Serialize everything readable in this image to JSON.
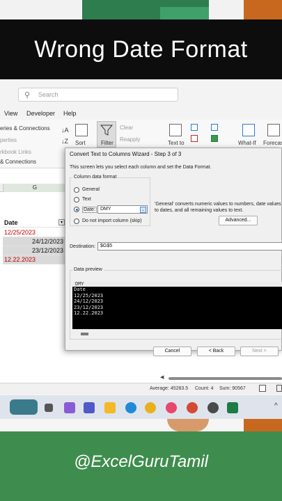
{
  "banner": {
    "title": "Wrong Date Format"
  },
  "search": {
    "placeholder": "Search"
  },
  "menu": {
    "items": [
      "View",
      "Developer",
      "Help"
    ]
  },
  "ribbon": {
    "queries": "eries & Connections",
    "properties": "perties",
    "edit_links": "rkbook Links",
    "group_label": "& Connections",
    "sort": "Sort",
    "filter": "Filter",
    "clear": "Clear",
    "reapply": "Reapply",
    "text_to": "Text to",
    "what_if": "What-If",
    "forecast": "Forecas"
  },
  "sheet": {
    "column": "G",
    "header": "Date",
    "cells": [
      "12/25/2023",
      "24/12/2023",
      "23/12/2023",
      "12.22.2023"
    ]
  },
  "dialog": {
    "title": "Convert Text to Columns Wizard - Step 3 of 3",
    "description": "This screen lets you select each column and set the Data Format.",
    "format_legend": "Column data format",
    "options": [
      "General",
      "Text",
      "Date:",
      "Do not import column (skip)"
    ],
    "date_value": "DMY",
    "hint": "'General' converts numeric values to numbers, date values to dates, and all remaining values to text.",
    "advanced": "Advanced...",
    "destination_label": "Destination:",
    "destination_value": "$G$5",
    "preview_legend": "Data preview",
    "preview_header": "DMY",
    "preview_rows": [
      "Date",
      "12/25/2023",
      "24/12/2023",
      "23/12/2023",
      "12.22.2023"
    ],
    "buttons": {
      "cancel": "Cancel",
      "back": "< Back",
      "next": "Next >"
    }
  },
  "status": {
    "average": "Average: 45283.5",
    "count": "Count: 4",
    "sum": "Sum: 90567"
  },
  "footer": {
    "handle": "@ExcelGuruTamil"
  }
}
